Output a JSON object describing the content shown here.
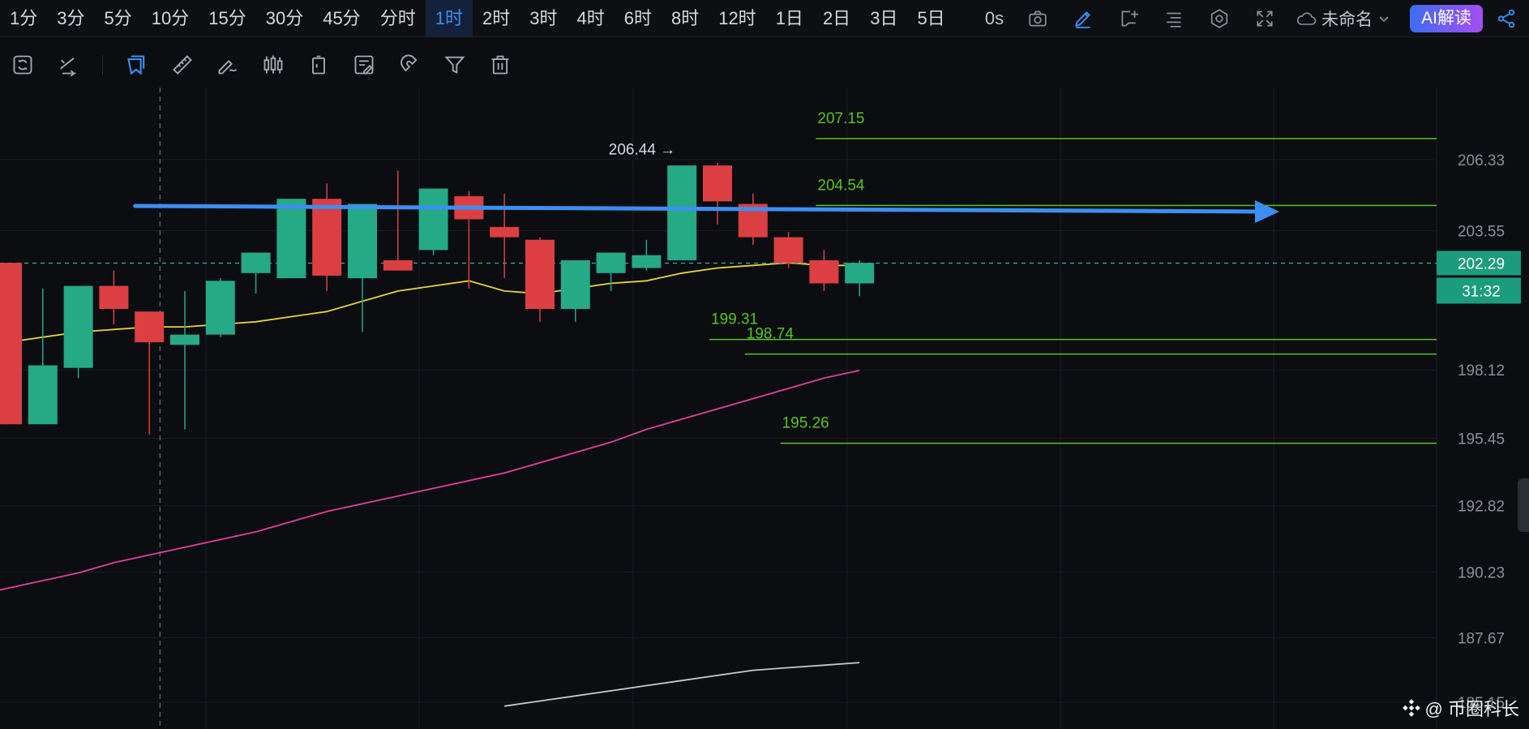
{
  "timeframes": [
    "1分",
    "3分",
    "5分",
    "10分",
    "15分",
    "30分",
    "45分",
    "分时",
    "1时",
    "2时",
    "3时",
    "4时",
    "6时",
    "8时",
    "12时",
    "1日",
    "2日",
    "3日",
    "5日"
  ],
  "active_timeframe": "1时",
  "topbar": {
    "countdown": "0s",
    "layout_name": "未命名",
    "ai_label": "AI解读"
  },
  "icons": {
    "top_right": [
      "camera-icon",
      "pencil-icon",
      "add-chart-icon",
      "indicator-list-icon",
      "settings-icon",
      "fullscreen-icon",
      "share-icon"
    ],
    "drawing_toolbar": [
      "refresh-icon",
      "swap-icon",
      "select-icon",
      "ruler-icon",
      "brush-icon",
      "candles-icon",
      "trash-outline-icon",
      "note-icon",
      "magnet-icon",
      "filter-icon",
      "delete-icon"
    ]
  },
  "colors": {
    "background": "#0b0d11",
    "up": "#26a985",
    "down": "#dc3f42",
    "ma_fast": "#e5d23c",
    "ma_mid": "#e2409d",
    "ma_slow": "#c8c8c8",
    "level": "#58c61f",
    "trend": "#3b8ff3",
    "grid": "#1a1d23",
    "axis_text": "#8b8f98"
  },
  "chart_data": {
    "type": "candlestick",
    "y_ticks": [
      206.33,
      203.55,
      198.12,
      195.45,
      192.82,
      190.23,
      187.67,
      185.15
    ],
    "ylim": [
      184.9,
      208.5
    ],
    "current_price": "202.29",
    "countdown": "31:32",
    "high_marker": "206.44",
    "candles": [
      {
        "o": 202.3,
        "h": 202.3,
        "c": 196.0,
        "l": 196.0
      },
      {
        "o": 196.0,
        "h": 201.3,
        "c": 198.3,
        "l": 196.0
      },
      {
        "o": 198.2,
        "h": 201.3,
        "c": 201.4,
        "l": 197.8
      },
      {
        "o": 201.4,
        "h": 202.0,
        "c": 200.5,
        "l": 199.9
      },
      {
        "o": 200.4,
        "h": 200.4,
        "c": 199.2,
        "l": 195.6
      },
      {
        "o": 199.1,
        "h": 201.2,
        "c": 199.5,
        "l": 195.8
      },
      {
        "o": 199.5,
        "h": 201.7,
        "c": 201.6,
        "l": 199.4
      },
      {
        "o": 201.9,
        "h": 202.3,
        "c": 202.7,
        "l": 201.1
      },
      {
        "o": 201.7,
        "h": 204.1,
        "c": 204.8,
        "l": 201.7
      },
      {
        "o": 204.8,
        "h": 205.4,
        "c": 201.8,
        "l": 201.2
      },
      {
        "o": 201.7,
        "h": 202.3,
        "c": 204.6,
        "l": 199.6
      },
      {
        "o": 202.4,
        "h": 205.9,
        "c": 202.0,
        "l": 202.0
      },
      {
        "o": 202.8,
        "h": 205.2,
        "c": 205.2,
        "l": 202.6
      },
      {
        "o": 204.9,
        "h": 205.1,
        "c": 204.0,
        "l": 201.3
      },
      {
        "o": 203.7,
        "h": 205.0,
        "c": 203.3,
        "l": 201.7
      },
      {
        "o": 203.2,
        "h": 203.3,
        "c": 200.5,
        "l": 200.0
      },
      {
        "o": 200.5,
        "h": 202.4,
        "c": 202.4,
        "l": 200.0
      },
      {
        "o": 201.9,
        "h": 202.5,
        "c": 202.7,
        "l": 201.2
      },
      {
        "o": 202.1,
        "h": 203.2,
        "c": 202.6,
        "l": 202.0
      },
      {
        "o": 202.4,
        "h": 206.1,
        "c": 206.1,
        "l": 202.4
      },
      {
        "o": 206.1,
        "h": 206.2,
        "c": 204.7,
        "l": 203.8
      },
      {
        "o": 204.6,
        "h": 205.0,
        "c": 203.3,
        "l": 203.0
      },
      {
        "o": 203.3,
        "h": 203.5,
        "c": 202.3,
        "l": 202.1
      },
      {
        "o": 202.4,
        "h": 202.8,
        "c": 201.5,
        "l": 201.2
      },
      {
        "o": 201.5,
        "h": 202.4,
        "c": 202.3,
        "l": 201.0
      }
    ],
    "ma_fast": [
      199.2,
      199.4,
      199.6,
      199.7,
      199.8,
      199.8,
      199.9,
      200.0,
      200.2,
      200.4,
      200.8,
      201.2,
      201.4,
      201.6,
      201.2,
      201.1,
      201.3,
      201.5,
      201.6,
      201.9,
      202.1,
      202.2,
      202.3,
      202.2,
      202.2
    ],
    "ma_mid": [
      188.1,
      188.4,
      188.7,
      189.0,
      189.3,
      189.6,
      189.9,
      190.2,
      190.6,
      190.9,
      191.2,
      191.5,
      191.8,
      192.2,
      192.6,
      192.9,
      193.2,
      193.5,
      193.8,
      194.1,
      194.5,
      194.9,
      195.3,
      195.8,
      196.2,
      196.6,
      197.0,
      197.4,
      197.8,
      198.1
    ],
    "ma_mid_start": -5,
    "ma_slow": [
      185.0,
      185.2,
      185.4,
      185.6,
      185.8,
      186.0,
      186.2,
      186.4,
      186.5,
      186.6,
      186.7
    ],
    "ma_slow_start": 14,
    "levels": [
      {
        "label": "207.15",
        "value": 207.15,
        "from": 23
      },
      {
        "label": "204.54",
        "value": 204.54,
        "from": 23
      },
      {
        "label": "199.31",
        "value": 199.31,
        "from": 20
      },
      {
        "label": "198.74",
        "value": 198.74,
        "from": 21
      },
      {
        "label": "195.26",
        "value": 195.26,
        "from": 22
      }
    ],
    "trend_line": {
      "from_index": 3.6,
      "from_value": 204.52,
      "to_value": 204.3
    },
    "crosshair_index": 4.3
  },
  "watermark": "@ 币圈科长"
}
